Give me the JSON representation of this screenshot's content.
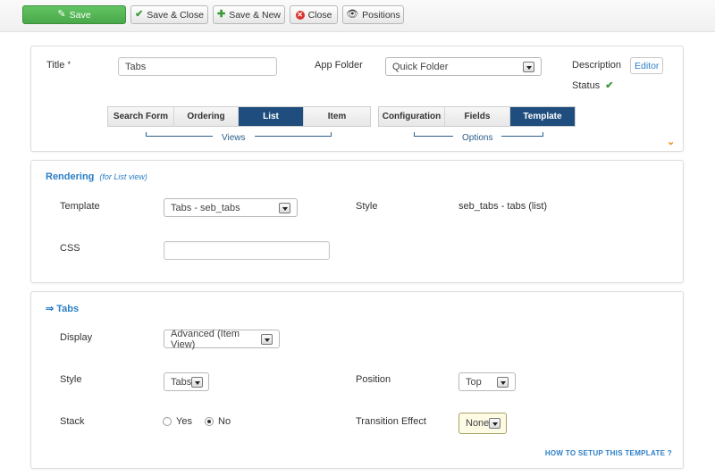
{
  "toolbar": {
    "save": "Save",
    "save_close": "Save & Close",
    "save_new": "Save & New",
    "close": "Close",
    "positions": "Positions"
  },
  "header": {
    "title_label": "Title",
    "required_mark": "*",
    "title_value": "Tabs",
    "app_folder_label": "App Folder",
    "app_folder_value": "Quick Folder",
    "description_label": "Description",
    "editor_button": "Editor",
    "status_label": "Status"
  },
  "view_tabs": [
    {
      "label": "Search Form",
      "active": false
    },
    {
      "label": "Ordering",
      "active": false
    },
    {
      "label": "List",
      "active": true
    },
    {
      "label": "Item",
      "active": false
    }
  ],
  "views_group_label": "Views",
  "option_tabs": [
    {
      "label": "Configuration",
      "active": false
    },
    {
      "label": "Fields",
      "active": false
    },
    {
      "label": "Template",
      "active": true
    }
  ],
  "options_group_label": "Options",
  "rendering": {
    "title": "Rendering",
    "subtitle": "(for List view)",
    "template_label": "Template",
    "template_value": "Tabs - seb_tabs",
    "style_label": "Style",
    "style_value": "seb_tabs - tabs (list)",
    "css_label": "CSS",
    "css_value": ""
  },
  "tabs_section": {
    "title": "⇒ Tabs",
    "display_label": "Display",
    "display_value": "Advanced (Item View)",
    "style_label": "Style",
    "style_value": "Tabs",
    "position_label": "Position",
    "position_value": "Top",
    "stack_label": "Stack",
    "stack_yes": "Yes",
    "stack_no": "No",
    "stack_selected": "No",
    "transition_label": "Transition Effect",
    "transition_value": "None",
    "howto_link": "HOW TO SETUP THIS TEMPLATE ?"
  },
  "colors": {
    "accent": "#2a7ec6",
    "active_tab": "#1f4e7e",
    "save_green": "#4aa84a",
    "status_check": "#3a9b3a",
    "collapse_arrow": "#e8901c"
  }
}
